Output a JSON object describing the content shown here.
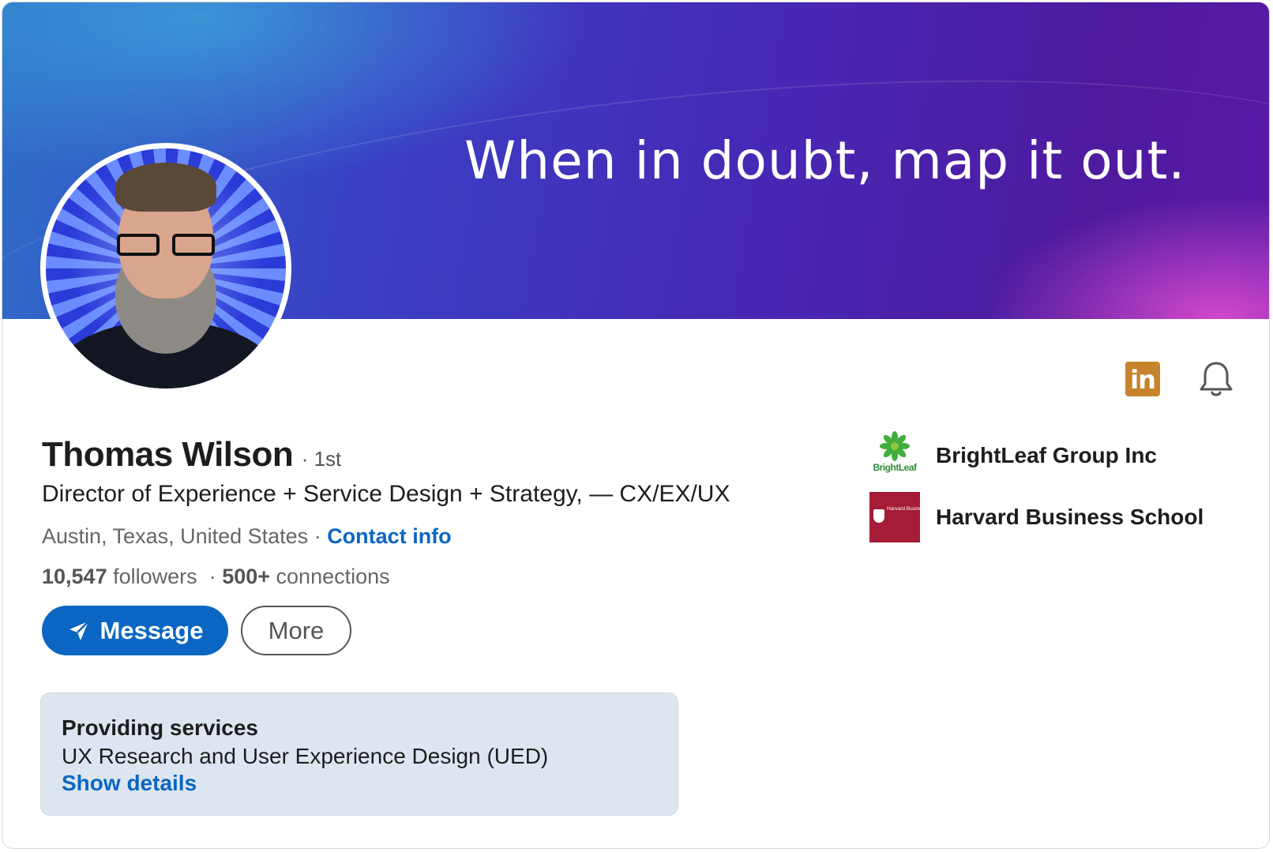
{
  "banner": {
    "tagline": "When in doubt, map it out."
  },
  "profile": {
    "name": "Thomas Wilson",
    "degree": "· 1st",
    "headline": "Director of Experience + Service Design + Strategy, — CX/EX/UX",
    "location": "Austin, Texas, United States",
    "location_separator": " · ",
    "contact_info_label": "Contact info",
    "followers_count": "10,547",
    "followers_label": "followers",
    "connections_separator": "·",
    "connections_count": "500+",
    "connections_label": "connections"
  },
  "actions": {
    "message_label": "Message",
    "more_label": "More"
  },
  "services": {
    "title": "Providing services",
    "description": "UX Research and User Experience Design (UED)",
    "show_details_label": "Show details"
  },
  "organizations": [
    {
      "name": "BrightLeaf Group Inc",
      "logo_text": "BrightLeaf",
      "logo": "brightleaf-logo"
    },
    {
      "name": "Harvard Business School",
      "logo_text": "Harvard Business School",
      "logo": "harvard-business-school-logo"
    }
  ],
  "icons": {
    "premium_badge": "linkedin-icon",
    "notifications": "bell-icon",
    "message_button_icon": "send-icon"
  },
  "colors": {
    "accent": "#0a66c2",
    "premium_badge": "#c5842b",
    "services_background": "#dde6f0",
    "hbs_crimson": "#a41c35"
  }
}
